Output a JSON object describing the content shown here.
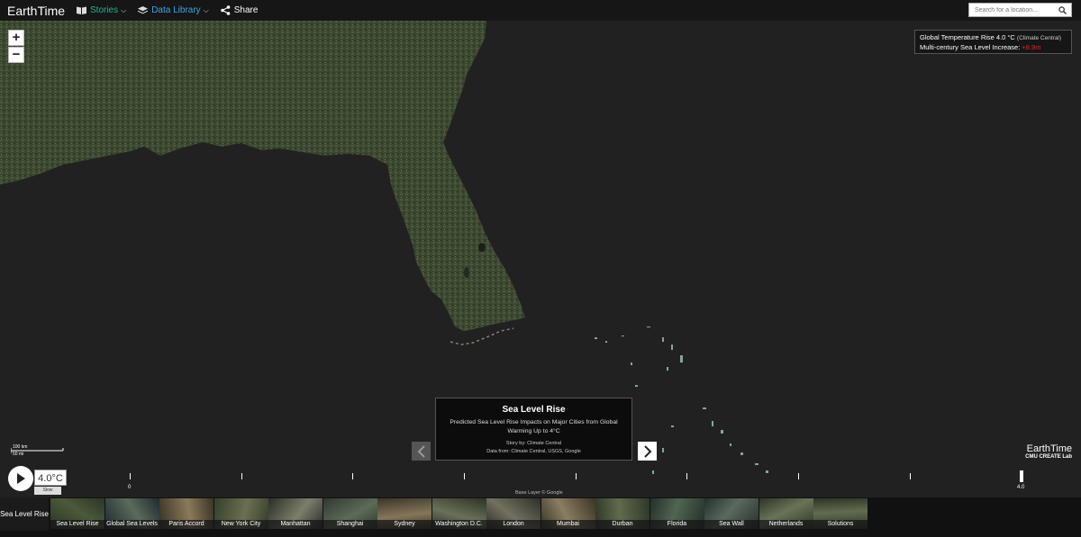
{
  "topbar": {
    "brand": "EarthTime",
    "stories_label": "Stories",
    "data_library_label": "Data Library",
    "share_label": "Share",
    "search_placeholder": "Search for a location..."
  },
  "info": {
    "temp_label": "Global Temperature Rise 4.0 °C",
    "temp_source": "(Climate Central)",
    "rise_label": "Multi-century Sea Level Increase:",
    "rise_value": "+8.9m"
  },
  "story_card": {
    "title": "Sea Level Rise",
    "subtitle": "Predicted Sea Level Rise Impacts on Major Cities from Global Warming Up to 4°C",
    "story_by": "Story by: Climate Central",
    "data_from": "Data from: Climate Central, USGS, Google"
  },
  "scale": {
    "km": "100 km",
    "mi": "50 mi"
  },
  "logo": {
    "title": "EarthTime",
    "lab": "CMU CREATE Lab"
  },
  "timeline": {
    "current_temp": "4.0°C",
    "speed": "Slow",
    "min_label": "0",
    "max_label": "4.0",
    "value": 4.0,
    "base_layer": "Base Layer © Google"
  },
  "bottom": {
    "story_label": "Sea Level Rise",
    "thumbnails": [
      {
        "label": "Sea Level Rise",
        "active": true
      },
      {
        "label": "Global Sea Levels",
        "active": false
      },
      {
        "label": "Paris Accord",
        "active": false
      },
      {
        "label": "New York City",
        "active": false
      },
      {
        "label": "Manhattan",
        "active": false
      },
      {
        "label": "Shanghai",
        "active": false
      },
      {
        "label": "Sydney",
        "active": false
      },
      {
        "label": "Washington D.C.",
        "active": false
      },
      {
        "label": "London",
        "active": false
      },
      {
        "label": "Mumbai",
        "active": false
      },
      {
        "label": "Durban",
        "active": false
      },
      {
        "label": "Florida",
        "active": false
      },
      {
        "label": "Sea Wall",
        "active": false
      },
      {
        "label": "Netherlands",
        "active": false
      },
      {
        "label": "Solutions",
        "active": false
      }
    ]
  },
  "colors": {
    "stories_accent": "#23b39a",
    "data_library_accent": "#3fa7e0",
    "rise_value": "#e02828",
    "active_thumb": "#3a8be8",
    "land": "#3d4a30",
    "ocean": "#212121"
  }
}
